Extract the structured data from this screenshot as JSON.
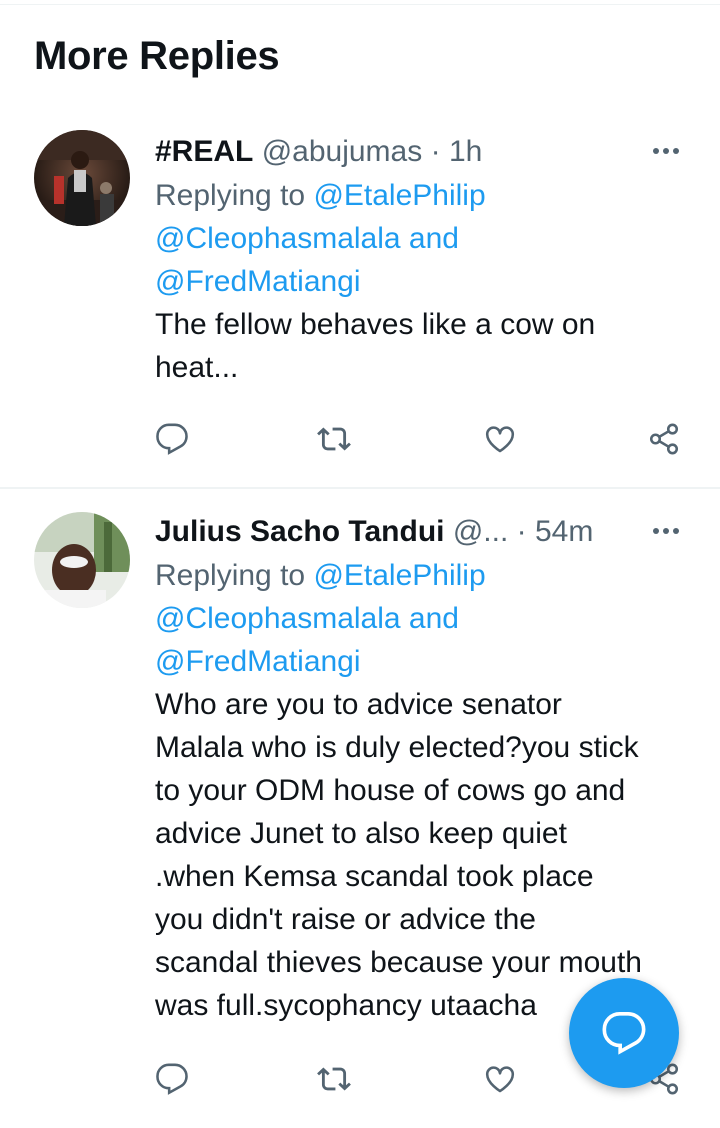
{
  "section": {
    "title": "More Replies"
  },
  "colors": {
    "accent": "#1d9bf0",
    "secondary_text": "#536471",
    "primary_text": "#0f1419"
  },
  "replies": [
    {
      "display_name": "#REAL",
      "handle": "@abujumas",
      "separator": "·",
      "time": "1h",
      "replying_prefix": "Replying to ",
      "mention_1": "@EtalePhilip",
      "mention_2": "@Cleophasmalala and",
      "mention_3": "@FredMatiangi",
      "text_lines": [
        "The fellow behaves like a cow on",
        "heat..."
      ],
      "icons": [
        "reply-icon",
        "retweet-icon",
        "like-icon",
        "share-icon"
      ]
    },
    {
      "display_name": "Julius Sacho Tandui",
      "handle": "@...",
      "separator": "·",
      "time": "54m",
      "replying_prefix": "Replying to ",
      "mention_1": "@EtalePhilip",
      "mention_2": "@Cleophasmalala and",
      "mention_3": "@FredMatiangi",
      "text_lines": [
        "Who are you to advice senator",
        "Malala who is duly elected?you stick",
        "to your ODM house of cows go and",
        "advice Junet to also keep quiet",
        ".when Kemsa scandal took place",
        "you didn't raise or advice the",
        "scandal thieves because your mouth",
        "was full.sycophancy utaacha"
      ],
      "icons": [
        "reply-icon",
        "retweet-icon",
        "like-icon",
        "share-icon"
      ]
    }
  ],
  "fab": {
    "icon": "compose-reply-icon"
  }
}
